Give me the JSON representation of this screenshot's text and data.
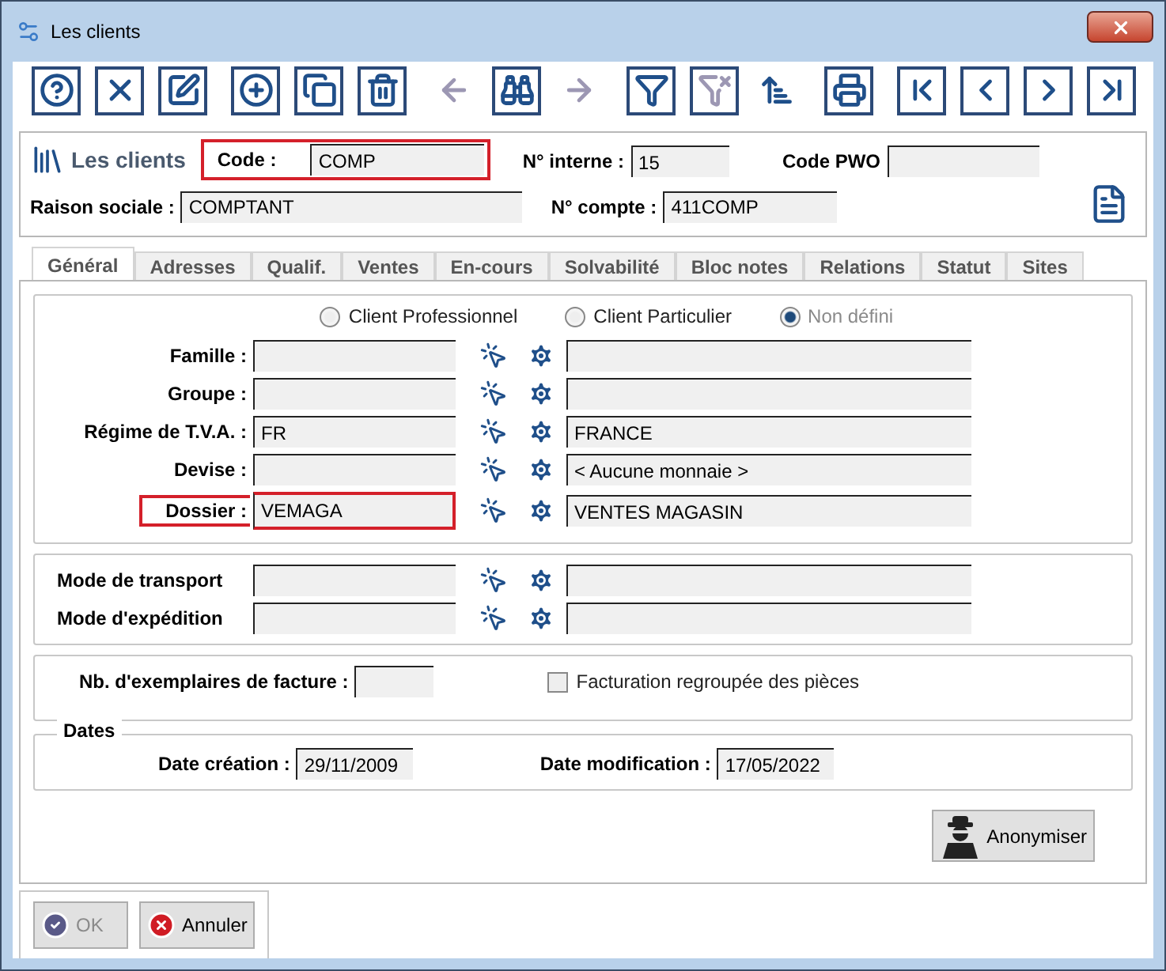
{
  "window": {
    "title": "Les clients"
  },
  "toolbar": [
    {
      "kind": "help",
      "disabled": false
    },
    {
      "kind": "close",
      "disabled": false
    },
    {
      "kind": "edit",
      "disabled": false
    },
    {
      "kind": "add",
      "disabled": false
    },
    {
      "kind": "copy",
      "disabled": false
    },
    {
      "kind": "delete",
      "disabled": false
    },
    {
      "kind": "back",
      "disabled": true
    },
    {
      "kind": "search",
      "disabled": false
    },
    {
      "kind": "forward",
      "disabled": true
    },
    {
      "kind": "filter",
      "disabled": false
    },
    {
      "kind": "unfilter",
      "disabled": true
    },
    {
      "kind": "sort",
      "disabled": false
    },
    {
      "kind": "print",
      "disabled": false
    },
    {
      "kind": "first",
      "disabled": false
    },
    {
      "kind": "prev",
      "disabled": false
    },
    {
      "kind": "next",
      "disabled": false
    },
    {
      "kind": "last",
      "disabled": false
    }
  ],
  "header": {
    "title": "Les clients",
    "code": {
      "label": "Code :",
      "value": "COMP",
      "highlighted": true
    },
    "numero_interne": {
      "label": "N° interne :",
      "value": "15"
    },
    "code_pwo": {
      "label": "Code PWO"
    },
    "raison_sociale": {
      "label": "Raison sociale :",
      "value": "COMPTANT"
    },
    "numero_compte": {
      "label": "N° compte :",
      "value": "411COMP"
    }
  },
  "tabs": [
    {
      "label": "Général",
      "selected": true
    },
    {
      "label": "Adresses",
      "selected": false
    },
    {
      "label": "Qualif.",
      "selected": false
    },
    {
      "label": "Ventes",
      "selected": false
    },
    {
      "label": "En-cours",
      "selected": false
    },
    {
      "label": "Solvabilité",
      "selected": false
    },
    {
      "label": "Bloc notes",
      "selected": false
    },
    {
      "label": "Relations",
      "selected": false
    },
    {
      "label": "Statut",
      "selected": false
    },
    {
      "label": "Sites",
      "selected": false
    }
  ],
  "client_type": [
    {
      "label": "Client Professionnel",
      "selected": false,
      "disabled": false
    },
    {
      "label": "Client Particulier",
      "selected": false,
      "disabled": false
    },
    {
      "label": "Non défini",
      "selected": true,
      "disabled": true
    }
  ],
  "general_rows": [
    {
      "label": "Famille :",
      "highlighted": false
    },
    {
      "label": "Groupe :",
      "highlighted": false
    },
    {
      "label": "Régime de T.V.A. :",
      "value": "FR",
      "description": "FRANCE",
      "highlighted": false
    },
    {
      "label": "Devise :",
      "description": "< Aucune monnaie >",
      "highlighted": false
    },
    {
      "label": "Dossier :",
      "value": "VEMAGA",
      "description": "VENTES MAGASIN",
      "highlighted": true
    }
  ],
  "transport_rows": [
    {
      "label": "Mode de transport"
    },
    {
      "label": "Mode d'expédition"
    }
  ],
  "invoice": {
    "label": "Nb. d'exemplaires de facture :",
    "grouped": {
      "label": "Facturation regroupée des pièces",
      "checked": false
    }
  },
  "dates": {
    "legend": "Dates",
    "creation": {
      "label": "Date création :",
      "value": "29/11/2009"
    },
    "modification": {
      "label": "Date modification :",
      "value": "17/05/2022"
    }
  },
  "anonymise_button": {
    "label": "Anonymiser"
  },
  "buttons": [
    {
      "kind": "ok",
      "label": "OK",
      "disabled": true
    },
    {
      "kind": "cancel",
      "label": "Annuler",
      "disabled": false
    }
  ]
}
